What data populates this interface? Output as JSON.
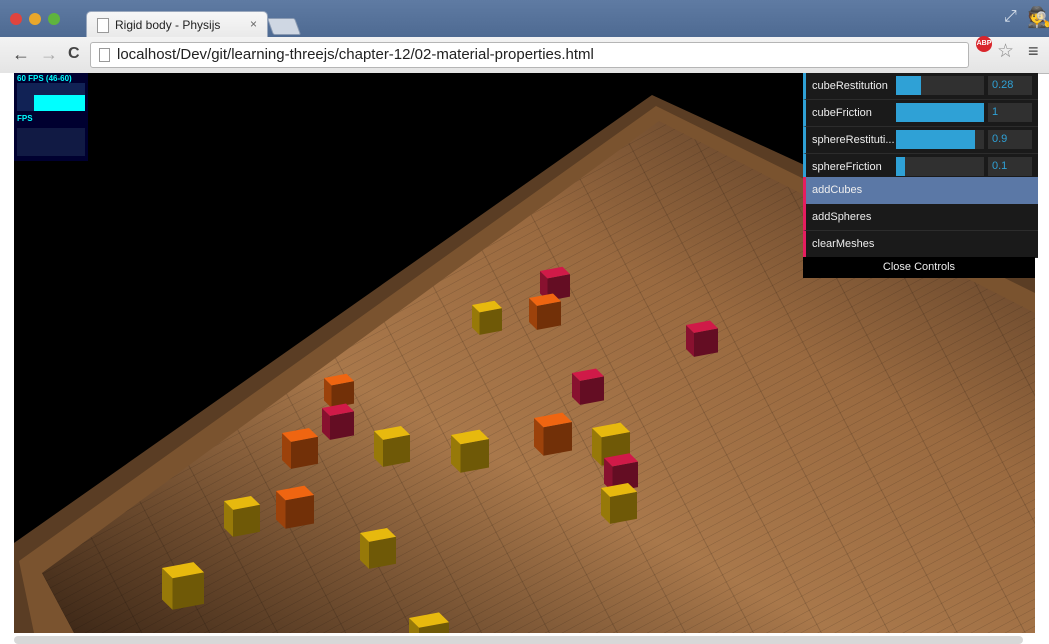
{
  "browser": {
    "tab_title": "Rigid body - Physijs",
    "tab_close": "×",
    "url": "localhost/Dev/git/learning-threejs/chapter-12/02-material-properties.html",
    "back_glyph": "←",
    "forward_glyph": "→",
    "reload_glyph": "C",
    "adblock_label": "ABP",
    "star_glyph": "☆",
    "menu_glyph": "≡",
    "icons": [
      "page-icon",
      "adblock-icon",
      "bookmark-star-icon",
      "menu-icon",
      "incognito-icon"
    ]
  },
  "stats": {
    "fps_label": "60 FPS (46-60)",
    "mode_label": "FPS"
  },
  "gui": {
    "controllers": [
      {
        "name": "cubeRestitution",
        "value": "0.28",
        "fraction": 0.28
      },
      {
        "name": "cubeFriction",
        "value": "1",
        "fraction": 1.0
      },
      {
        "name": "sphereRestituti...",
        "value": "0.9",
        "fraction": 0.9
      },
      {
        "name": "sphereFriction",
        "value": "0.1",
        "fraction": 0.1
      }
    ],
    "functions": [
      {
        "name": "addCubes",
        "highlighted": true
      },
      {
        "name": "addSpheres",
        "highlighted": false
      },
      {
        "name": "clearMeshes",
        "highlighted": false
      }
    ],
    "close_label": "Close Controls"
  },
  "colors": {
    "accent_number": "#2fa1d6",
    "accent_function": "#e61d5f",
    "cube_red": "#b5173f",
    "cube_orange": "#d0580f",
    "cube_yellow": "#c9a10c"
  }
}
